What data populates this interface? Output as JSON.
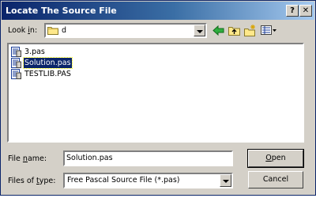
{
  "window": {
    "title": "Locate The Source File",
    "help_label": "?",
    "close_label": "✕"
  },
  "look_in": {
    "label_prefix": "Look ",
    "label_accel": "i",
    "label_suffix": "n:",
    "value": "d",
    "icon": "folder-icon"
  },
  "toolbar": {
    "back_icon": "back-arrow-icon",
    "up_icon": "up-folder-icon",
    "new_folder_icon": "new-folder-icon",
    "view_menu_icon": "view-menu-icon"
  },
  "files": [
    {
      "name": "3.pas",
      "icon": "pascal-file-icon",
      "selected": false
    },
    {
      "name": "Solution.pas",
      "icon": "pascal-file-icon",
      "selected": true
    },
    {
      "name": "TESTLIB.PAS",
      "icon": "pascal-file-icon",
      "selected": false
    }
  ],
  "file_name": {
    "label_prefix": "File ",
    "label_accel": "n",
    "label_suffix": "ame:",
    "value": "Solution.pas"
  },
  "file_type": {
    "label_prefix": "Files of ",
    "label_accel": "t",
    "label_suffix": "ype:",
    "value": "Free Pascal Source File (*.pas)"
  },
  "buttons": {
    "open_accel": "O",
    "open_rest": "pen",
    "cancel": "Cancel"
  },
  "colors": {
    "titlebar_start": "#0a246a",
    "titlebar_end": "#a6caf0",
    "face": "#d4d0c8",
    "selection": "#0a246a"
  }
}
